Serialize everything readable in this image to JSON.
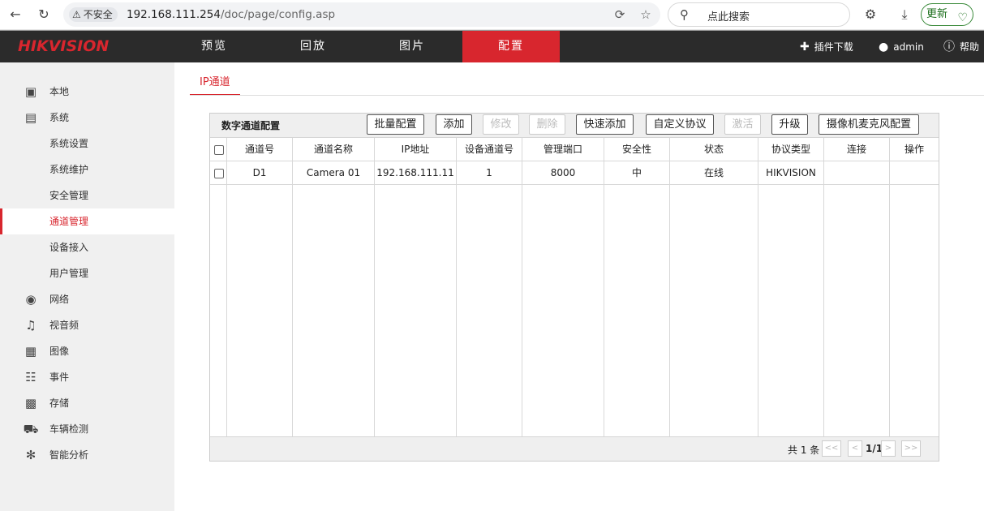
{
  "browser": {
    "security_label": "不安全",
    "url_host": "192.168.111.254",
    "url_path": "/doc/page/config.asp",
    "search_placeholder": "点此搜索",
    "update_label": "更新"
  },
  "header": {
    "logo": "HIKVISION",
    "tabs": [
      {
        "label": "预览",
        "active": false
      },
      {
        "label": "回放",
        "active": false
      },
      {
        "label": "图片",
        "active": false
      },
      {
        "label": "配置",
        "active": true
      }
    ],
    "plugin_label": "插件下载",
    "user_label": "admin",
    "help_label": "帮助",
    "accent_color": "#d8262e"
  },
  "sidebar": {
    "items": [
      {
        "label": "本地",
        "icon": "monitor-icon"
      },
      {
        "label": "系统",
        "icon": "system-icon"
      },
      {
        "label": "系统设置"
      },
      {
        "label": "系统维护"
      },
      {
        "label": "安全管理"
      },
      {
        "label": "通道管理",
        "active": true
      },
      {
        "label": "设备接入"
      },
      {
        "label": "用户管理"
      },
      {
        "label": "网络",
        "icon": "globe-icon"
      },
      {
        "label": "视音频",
        "icon": "mic-icon"
      },
      {
        "label": "图像",
        "icon": "image-icon"
      },
      {
        "label": "事件",
        "icon": "event-icon"
      },
      {
        "label": "存储",
        "icon": "storage-icon"
      },
      {
        "label": "车辆检测",
        "icon": "vehicle-icon"
      },
      {
        "label": "智能分析",
        "icon": "analysis-icon"
      }
    ]
  },
  "main": {
    "tab_label": "IP通道",
    "panel_title": "数字通道配置",
    "buttons": [
      {
        "label": "批量配置",
        "enabled": true
      },
      {
        "label": "添加",
        "enabled": true
      },
      {
        "label": "修改",
        "enabled": false
      },
      {
        "label": "删除",
        "enabled": false
      },
      {
        "label": "快速添加",
        "enabled": true
      },
      {
        "label": "自定义协议",
        "enabled": true
      },
      {
        "label": "激活",
        "enabled": false
      },
      {
        "label": "升级",
        "enabled": true
      },
      {
        "label": "摄像机麦克风配置",
        "enabled": true
      }
    ],
    "columns": [
      "通道号",
      "通道名称",
      "IP地址",
      "设备通道号",
      "管理端口",
      "安全性",
      "状态",
      "协议类型",
      "连接",
      "操作"
    ],
    "rows": [
      [
        "D1",
        "Camera 01",
        "192.168.111.11",
        "1",
        "8000",
        "中",
        "在线",
        "HIKVISION",
        "",
        ""
      ]
    ],
    "footer": {
      "count_text": "共 1 条",
      "first": "<<",
      "prev": "<",
      "page": "1/1",
      "next": ">",
      "last": ">>"
    }
  }
}
